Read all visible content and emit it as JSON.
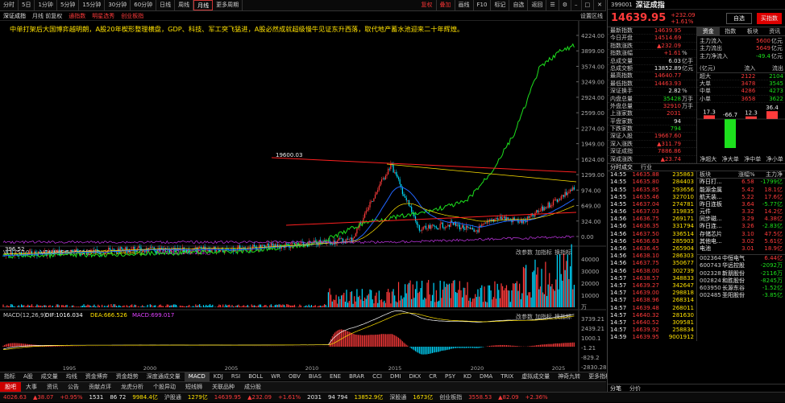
{
  "toolbar": {
    "periods": [
      "分时",
      "5日",
      "1分钟",
      "5分钟",
      "15分钟",
      "30分钟",
      "60分钟",
      "日线",
      "周线",
      "月线",
      "更多周期"
    ],
    "active_period": "月线",
    "right_items": [
      "复权",
      "叠加",
      "画线",
      "F10",
      "标记",
      "自选",
      "返回"
    ],
    "right_icons": [
      "menu-icon",
      "settings-icon",
      "minus-icon",
      "expand-icon",
      "close-icon"
    ]
  },
  "subbar": {
    "name": "深证成指",
    "mode": "月线 前复权",
    "tags": [
      "通指数",
      "明星选秀",
      "创业板指"
    ],
    "setting": "设置区线"
  },
  "banner": "中单打架后大国博弈越明朗，A股20年楔形整理横盘，GDP、科技、军工突飞猛进，A股必然成就超级慢牛见证东升西落，取代地产蓄水池迎来二十年辉煌。",
  "chart_labels": {
    "high": "19600.03",
    "low": "396.52",
    "price_axis": [
      "4224.00",
      "3899.00",
      "3574.00",
      "3249.00",
      "2924.00",
      "2599.00",
      "2274.00",
      "1949.00",
      "1624.00",
      "1299.00",
      "974.00",
      "649.00",
      "324.00",
      "0.00"
    ],
    "vol_legend": [
      "VOL(5,10)",
      "VOLUME:57.961亿",
      "MAVOL1:134.945亿",
      "MAVOL2:145.103亿"
    ],
    "vol_axis": [
      "40000",
      "30000",
      "20000",
      "10000"
    ],
    "vol_unit": "万",
    "macd_legend": [
      "MACD(12,26,9)",
      "DIF:1016.034",
      "DEA:666.526",
      "MACD:699.017"
    ],
    "macd_axis": [
      "3739.21",
      "2439.21",
      "1000.1",
      "-1.21",
      "-829.2",
      "-2830.28"
    ],
    "years": [
      "1995",
      "2000",
      "2005",
      "2010",
      "2015",
      "2020",
      "2025"
    ],
    "panel_btns": [
      "改参数",
      "加指标",
      "换指标"
    ]
  },
  "indicators": [
    "指标",
    "A股",
    "成交量",
    "均线",
    "资金博弈",
    "资金趋势",
    "深度通成交量",
    "MACD",
    "KDJ",
    "RSI",
    "BOLL",
    "WR",
    "OBV",
    "BIAS",
    "ENE",
    "BRAR",
    "CCI",
    "DMI",
    "DKX",
    "CR",
    "PSY",
    "KD",
    "DMA",
    "TRIX",
    "虚拟成交量",
    "神奇九转",
    "更多指标",
    "模板"
  ],
  "active_indicator": "MACD",
  "bottom_tabs": [
    "股吧",
    "大事",
    "资讯",
    "公告",
    "贡献点评",
    "龙虎分析",
    "个股异动",
    "短线狮",
    "关联品种",
    "成分股"
  ],
  "quote": {
    "code": "399001",
    "name": "深证成指",
    "price": "14639.95",
    "chg": "+232.09",
    "pct": "+1.61%",
    "add_btn": "自选",
    "buy_btn": "买指数",
    "rows": [
      {
        "k": "最新指数",
        "v": "14639.95",
        "u": "",
        "c": "red"
      },
      {
        "k": "今日开盘",
        "v": "14514.69",
        "u": "",
        "c": "red"
      },
      {
        "k": "指数涨跌",
        "v": "▲232.09",
        "u": "",
        "c": "red"
      },
      {
        "k": "指数涨幅",
        "v": "+1.61",
        "u": "%",
        "c": "red"
      },
      {
        "k": "总成交量",
        "v": "6.03",
        "u": "亿手",
        "c": "wht"
      },
      {
        "k": "总成交额",
        "v": "13852.89",
        "u": "亿元",
        "c": "wht"
      },
      {
        "k": "最高指数",
        "v": "14640.77",
        "u": "",
        "c": "red"
      },
      {
        "k": "最低指数",
        "v": "14463.93",
        "u": "",
        "c": "red"
      },
      {
        "k": "深证换手",
        "v": "2.82",
        "u": "%",
        "c": "wht"
      },
      {
        "k": "内盘总量",
        "v": "35428",
        "u": "万手",
        "c": "grn"
      },
      {
        "k": "外盘总量",
        "v": "32910",
        "u": "万手",
        "c": "red"
      },
      {
        "k": "上涨家数",
        "v": "2031",
        "u": "",
        "c": "red"
      },
      {
        "k": "平盘家数",
        "v": "94",
        "u": "",
        "c": "wht"
      },
      {
        "k": "下跌家数",
        "v": "794",
        "u": "",
        "c": "grn"
      },
      {
        "k": "深证入股",
        "v": "19667.60",
        "u": "",
        "c": "red"
      },
      {
        "k": "深入涨跌",
        "v": "▲311.79",
        "u": "",
        "c": "red"
      },
      {
        "k": "深证成指",
        "v": "7886.86",
        "u": "",
        "c": "red"
      },
      {
        "k": "深成涨跌",
        "v": "▲23.74",
        "u": "",
        "c": "red"
      }
    ],
    "flow_tabs": [
      "资金",
      "指数",
      "板块",
      "资讯"
    ],
    "flow": [
      {
        "k": "主力流入",
        "v": "5600",
        "u": "亿元"
      },
      {
        "k": "主力流出",
        "v": "5649",
        "u": "亿元"
      },
      {
        "k": "主力净流入",
        "v": "-49.4",
        "u": "亿元"
      }
    ],
    "flow_table_head": [
      "(亿元)",
      "流入",
      "流出"
    ],
    "flow_table": [
      {
        "k": "超大",
        "in": "2122",
        "out": "2104"
      },
      {
        "k": "大单",
        "in": "3478",
        "out": "3545"
      },
      {
        "k": "中单",
        "in": "4286",
        "out": "4273"
      },
      {
        "k": "小单",
        "in": "3658",
        "out": "3622"
      }
    ],
    "net_bars": [
      17.3,
      -66.7,
      12.3,
      36.4
    ],
    "net_labels": [
      "超大",
      "大单",
      "中单",
      "小单"
    ],
    "net_tabs": [
      "净超大",
      "净大单",
      "净中单",
      "净小单"
    ],
    "ticks_tabs": [
      "分时成交",
      "行业"
    ],
    "ticks": [
      {
        "t": "14:55",
        "p": "14635.88",
        "v": "235863"
      },
      {
        "t": "14:55",
        "p": "14635.80",
        "v": "284403"
      },
      {
        "t": "14:55",
        "p": "14635.85",
        "v": "293656"
      },
      {
        "t": "14:55",
        "p": "14635.46",
        "v": "327010"
      },
      {
        "t": "14:55",
        "p": "14637.04",
        "v": "274781"
      },
      {
        "t": "14:56",
        "p": "14637.03",
        "v": "319835"
      },
      {
        "t": "14:56",
        "p": "14636.75",
        "v": "269171"
      },
      {
        "t": "14:56",
        "p": "14636.35",
        "v": "331794"
      },
      {
        "t": "14:56",
        "p": "14637.50",
        "v": "336514"
      },
      {
        "t": "14:56",
        "p": "14636.63",
        "v": "285903"
      },
      {
        "t": "14:56",
        "p": "14636.45",
        "v": "265904"
      },
      {
        "t": "14:56",
        "p": "14638.10",
        "v": "286303"
      },
      {
        "t": "14:56",
        "p": "14637.75",
        "v": "350677"
      },
      {
        "t": "14:56",
        "p": "14638.00",
        "v": "302739"
      },
      {
        "t": "14:57",
        "p": "14638.57",
        "v": "348833"
      },
      {
        "t": "14:57",
        "p": "14639.27",
        "v": "342647"
      },
      {
        "t": "14:57",
        "p": "14639.00",
        "v": "298818"
      },
      {
        "t": "14:57",
        "p": "14638.96",
        "v": "268314"
      },
      {
        "t": "14:57",
        "p": "14639.48",
        "v": "268011"
      },
      {
        "t": "14:57",
        "p": "14640.32",
        "v": "281630"
      },
      {
        "t": "14:57",
        "p": "14640.52",
        "v": "309581"
      },
      {
        "t": "14:57",
        "p": "14639.92",
        "v": "258834"
      },
      {
        "t": "14:59",
        "p": "14639.95",
        "v": "9001912"
      }
    ],
    "ticks_bottom": [
      "分笔",
      "分价"
    ],
    "sectors_head": [
      "板块",
      "涨幅%",
      "主力净"
    ],
    "sectors": [
      {
        "n": "昨日打...",
        "p": "6.58",
        "f": "-1799亿"
      },
      {
        "n": "能源金属",
        "p": "5.42",
        "f": "18.1亿"
      },
      {
        "n": "航天装...",
        "p": "5.22",
        "f": "17.6亿"
      },
      {
        "n": "昨日连板",
        "p": "3.64",
        "f": "-5.77亿"
      },
      {
        "n": "元件",
        "p": "3.32",
        "f": "14.2亿"
      },
      {
        "n": "同步磁...",
        "p": "3.29",
        "f": "4.38亿"
      },
      {
        "n": "昨日连...",
        "p": "3.26",
        "f": "-2.83亿"
      },
      {
        "n": "存储芯片",
        "p": "3.10",
        "f": "47.5亿"
      },
      {
        "n": "其他电...",
        "p": "3.02",
        "f": "5.61亿"
      },
      {
        "n": "电池",
        "p": "3.01",
        "f": "18.9亿"
      }
    ],
    "stocks": [
      {
        "c": "002364",
        "n": "中恒电气",
        "p": "6.44亿"
      },
      {
        "c": "600743",
        "n": "华远控股",
        "p": "-2092万"
      },
      {
        "c": "002328",
        "n": "新朋股份",
        "p": "-2116万"
      },
      {
        "c": "002824",
        "n": "和胜股份",
        "p": "-8245万"
      },
      {
        "c": "603950",
        "n": "长源东谷",
        "p": "-1.52亿"
      },
      {
        "c": "002485",
        "n": "圣阳股份",
        "p": "-3.85亿"
      }
    ]
  },
  "status": {
    "items": [
      {
        "t": "4026.63",
        "c": "red"
      },
      {
        "t": "▲38.07",
        "c": "red"
      },
      {
        "t": "+0.95%",
        "c": "red"
      },
      {
        "t": "1531",
        "c": "wht"
      },
      {
        "t": "86 72",
        "c": "wht"
      },
      {
        "t": "9984.4亿",
        "c": "yel"
      },
      {
        "t": "沪股通",
        "c": "lab"
      },
      {
        "t": "1279亿",
        "c": "yel"
      },
      {
        "t": "14639.95",
        "c": "red"
      },
      {
        "t": "▲232.09",
        "c": "red"
      },
      {
        "t": "+1.61%",
        "c": "red"
      },
      {
        "t": "2031",
        "c": "wht"
      },
      {
        "t": "94 794",
        "c": "wht"
      },
      {
        "t": "13852.9亿",
        "c": "yel"
      },
      {
        "t": "深股通",
        "c": "lab"
      },
      {
        "t": "1673亿",
        "c": "yel"
      },
      {
        "t": "创业板指",
        "c": "lab"
      },
      {
        "t": "3558.53",
        "c": "red"
      },
      {
        "t": "▲82.09",
        "c": "red"
      },
      {
        "t": "+2.36%",
        "c": "red"
      }
    ]
  }
}
